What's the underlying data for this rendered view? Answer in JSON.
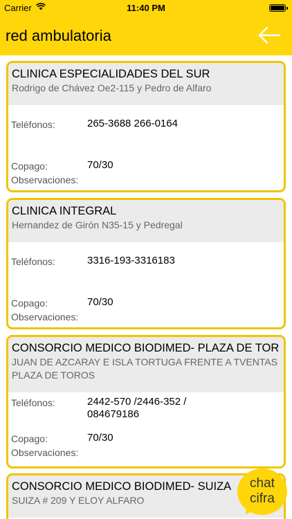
{
  "status_bar": {
    "carrier": "Carrier",
    "time": "11:40 PM"
  },
  "nav": {
    "title": "red ambulatoria",
    "back_icon": "arrow-left-icon"
  },
  "labels": {
    "phones": "Teléfonos:",
    "copay": "Copago:",
    "observations": "Observaciones:"
  },
  "clinics": [
    {
      "name": "CLINICA ESPECIALIDADES DEL SUR",
      "address": "Rodrigo de Chávez Oe2-115 y Pedro de Alfaro",
      "phones": "265-3688  266-0164",
      "copay": "70/30",
      "observations": ""
    },
    {
      "name": "CLINICA INTEGRAL",
      "address": "Hernandez de Girón N35-15 y Pedregal",
      "phones": "3316-193-3316183",
      "copay": "70/30",
      "observations": ""
    },
    {
      "name": "CONSORCIO MEDICO BIODIMED- PLAZA DE TOROS",
      "address": "JUAN DE AZCARAY E ISLA TORTUGA FRENTE A TVENTAS PLAZA DE TOROS",
      "phones": "2442-570  /2446-352 / 084679186",
      "copay": "70/30",
      "observations": ""
    },
    {
      "name": "CONSORCIO MEDICO BIODIMED- SUIZA",
      "address": "SUIZA # 209 Y ELOY ALFARO"
    }
  ],
  "chat_button": {
    "line1": "chat",
    "line2": "cifra"
  },
  "colors": {
    "accent": "#ffd60a",
    "card_border": "#f2c400",
    "card_header": "#ebebeb"
  }
}
